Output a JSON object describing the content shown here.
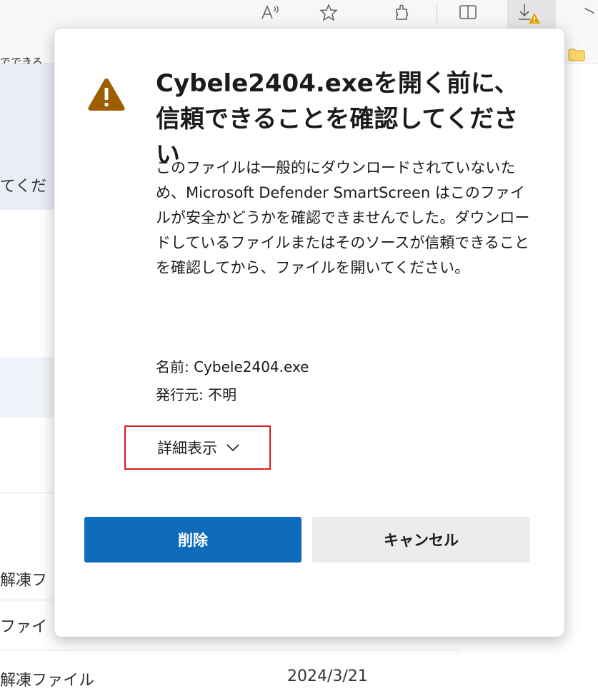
{
  "browser": {
    "toolbar_icons": [
      "read-aloud-icon",
      "favorite-star-icon",
      "extensions-icon",
      "split-screen-icon",
      "downloads-warning-icon"
    ],
    "bookmark_fragment": "でできる"
  },
  "background_page": {
    "fragments": [
      "てくだ",
      "解凍フ",
      "ファイ",
      "解凍ファイル"
    ],
    "date": "2024/3/21",
    "band_color": "#e8edf7"
  },
  "dialog": {
    "icon": "warning-triangle-icon",
    "title": "Cybele2404.exeを開く前に、信頼できることを確認してください",
    "body": "このファイルは一般的にダウンロードされていないため、Microsoft Defender SmartScreen はこのファイルが安全かどうかを確認できませんでした。ダウンロードしているファイルまたはそのソースが信頼できることを確認してから、ファイルを開いてください。",
    "name_line": "名前: Cybele2404.exe",
    "publisher_line": "発行元: 不明",
    "details_label": "詳細表示",
    "delete_label": "削除",
    "cancel_label": "キャンセル",
    "colors": {
      "primary": "#0f6cbd",
      "warning": "#9d5d00",
      "highlight": "#e01b1b"
    }
  }
}
